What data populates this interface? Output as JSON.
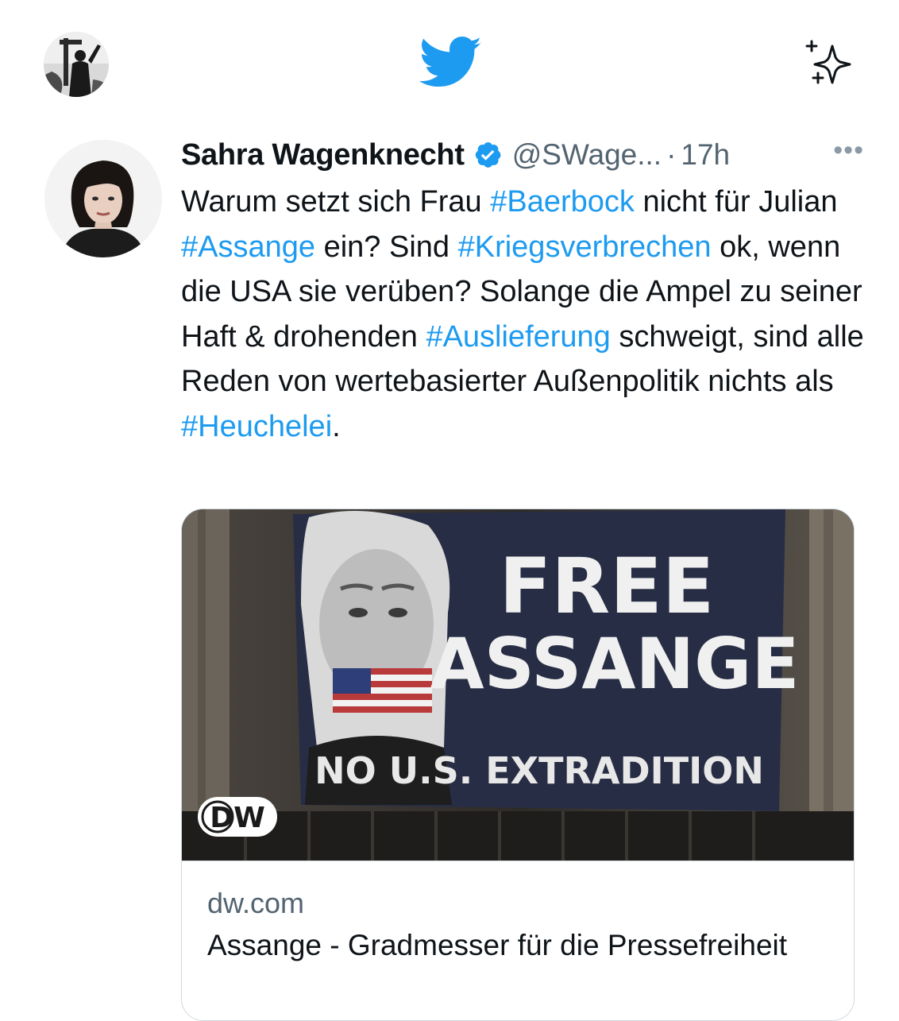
{
  "header": {
    "logo_icon": "twitter-bird-icon",
    "sparkle_icon": "sparkle-icon",
    "brand_color": "#1d9bf0"
  },
  "tweet": {
    "author_name": "Sahra Wagenknecht",
    "verified_icon": "verified-badge-icon",
    "handle": "@SWage...",
    "separator": "·",
    "time": "17h",
    "more_icon": "more-options-icon",
    "text_parts": [
      {
        "t": "Warum setzt sich Frau "
      },
      {
        "t": "#Baerbock",
        "tag": true
      },
      {
        "t": " nicht für Julian "
      },
      {
        "t": "#Assange",
        "tag": true
      },
      {
        "t": " ein? Sind "
      },
      {
        "t": "#Kriegsverbrechen",
        "tag": true
      },
      {
        "t": " ok, wenn die USA sie verüben? Solange die Ampel zu seiner Haft & drohenden "
      },
      {
        "t": "#Auslieferung",
        "tag": true
      },
      {
        "t": " schweigt, sind alle Reden von wertebasierter Außenpolitik nichts als "
      },
      {
        "t": "#Heuchelei",
        "tag": true
      },
      {
        "t": "."
      }
    ],
    "card": {
      "image": {
        "banner_line1": "FREE",
        "banner_line2": "ASSANGE",
        "banner_line3": "NO U.S. EXTRADITION",
        "logo": "DW"
      },
      "domain": "dw.com",
      "title": "Assange - Gradmesser für die Pressefreiheit"
    }
  }
}
